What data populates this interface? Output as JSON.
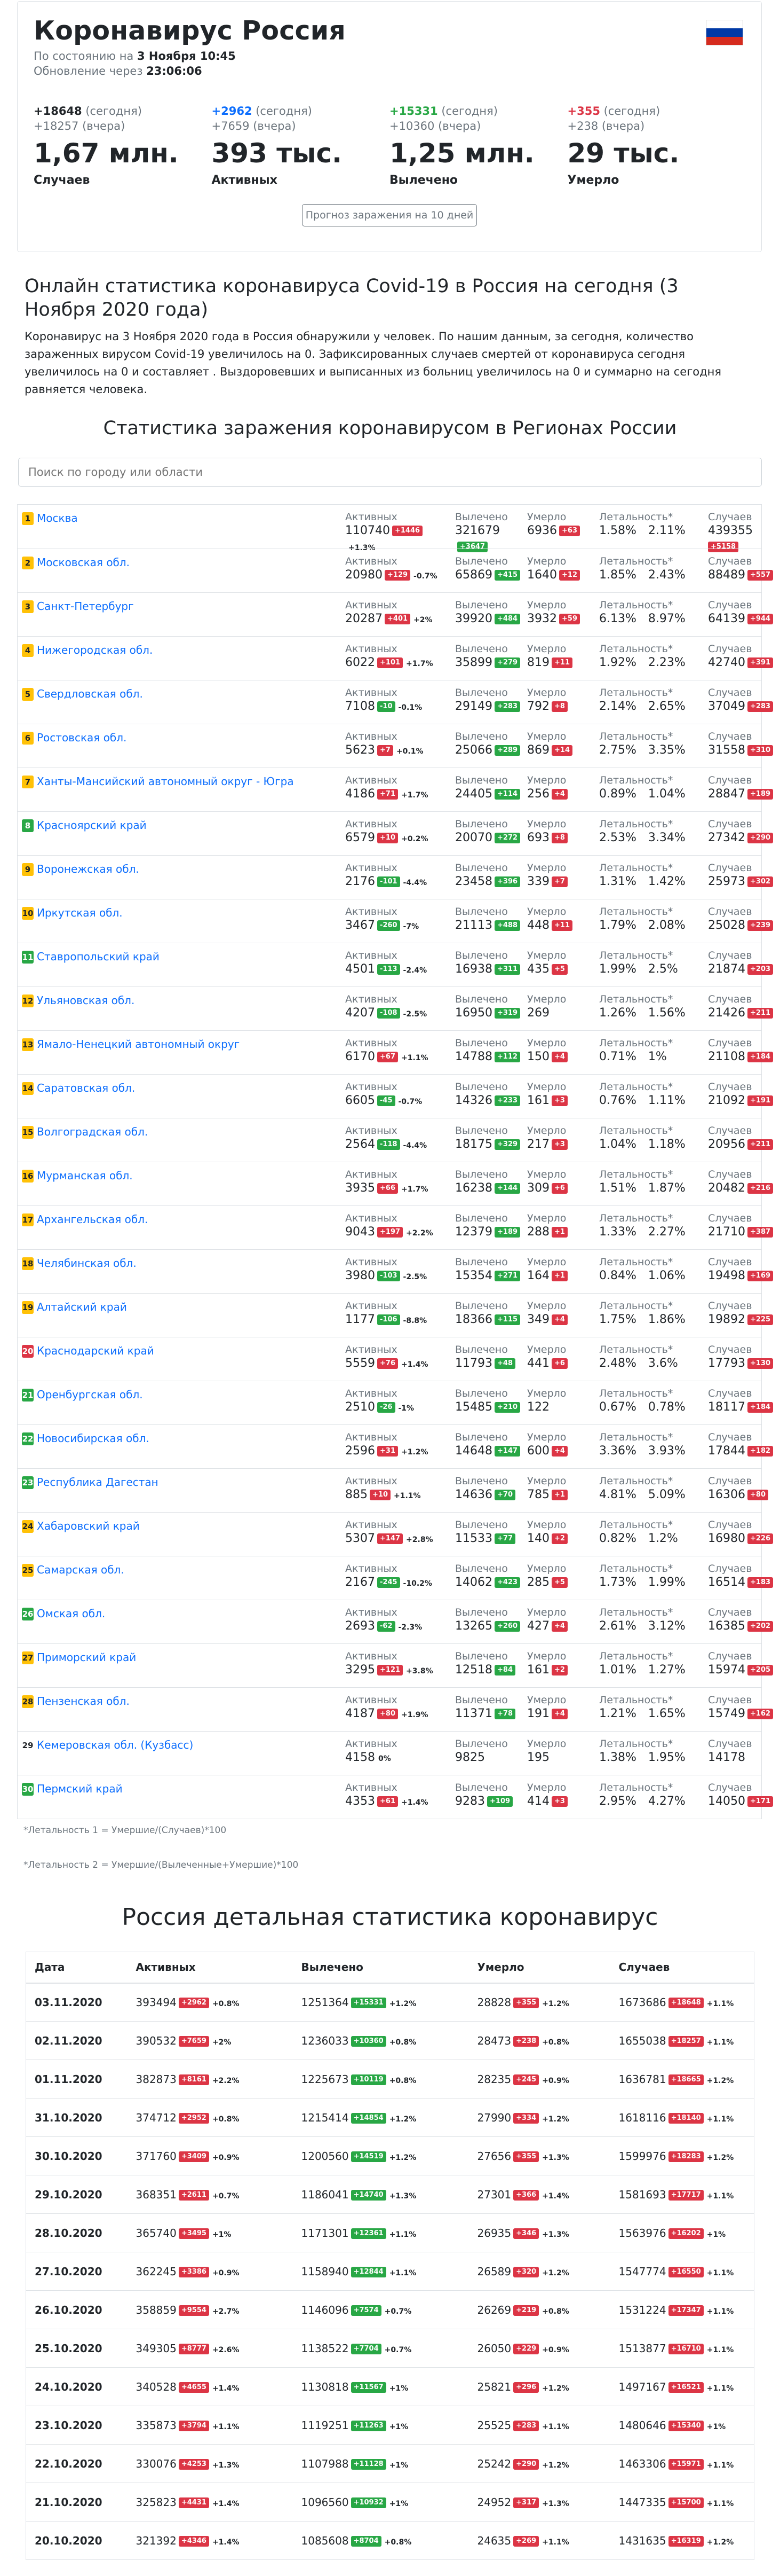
{
  "header": {
    "title": "Коронавирус Россия",
    "as_of_prefix": "По состоянию на",
    "as_of": "3 Ноября 10:45",
    "update_prefix": "Обновление через",
    "update_in": "23:06:06",
    "flag_colors": [
      "#ffffff",
      "#0039a6",
      "#d52b1e"
    ]
  },
  "stats": [
    {
      "today": "+18648",
      "today_lbl": "(сегодня)",
      "yest": "+18257",
      "yest_lbl": "(вчера)",
      "big": "1,67 млн.",
      "label": "Случаев",
      "color": "dark"
    },
    {
      "today": "+2962",
      "today_lbl": "(сегодня)",
      "yest": "+7659",
      "yest_lbl": "(вчера)",
      "big": "393 тыс.",
      "label": "Активных",
      "color": "blue"
    },
    {
      "today": "+15331",
      "today_lbl": "(сегодня)",
      "yest": "+10360",
      "yest_lbl": "(вчера)",
      "big": "1,25 млн.",
      "label": "Вылечено",
      "color": "green"
    },
    {
      "today": "+355",
      "today_lbl": "(сегодня)",
      "yest": "+238",
      "yest_lbl": "(вчера)",
      "big": "29 тыс.",
      "label": "Умерло",
      "color": "red"
    }
  ],
  "forecast_button": "Прогноз заражения на 10 дней",
  "intro": {
    "title": "Онлайн статистика коронавируса Covid-19 в Россия на сегодня (3 Ноября 2020 года)",
    "text": "Коронавирус на 3 Ноября 2020 года в Россия обнаружили у человек. По нашим данным, за сегодня, количество зараженных вирусом Covid-19 увеличилось на 0. Зафиксированных случаев смертей от коронавируса сегодня увеличилось на 0 и составляет . Выздоровевших и выписанных из больниц увеличилось на 0 и суммарно на сегодня равняется человека."
  },
  "regions_title": "Статистика заражения коронавирусом в Регионах России",
  "search_placeholder": "Поиск по городу или области",
  "col_labels": {
    "active": "Активных",
    "recovered": "Вылечено",
    "died": "Умерло",
    "leth": "Летальность*",
    "cases": "Случаев"
  },
  "regions": [
    {
      "rank": "1",
      "rc": "#ffc107",
      "name": "Москва",
      "active": "110740",
      "active_d": "+1446",
      "active_p": "+1.3%",
      "rec": "321679",
      "rec_d": "+3647",
      "died": "6936",
      "died_d": "+63",
      "l1": "1.58%",
      "l2": "2.11%",
      "cases": "439355",
      "cases_d": "+5158",
      "stack": true
    },
    {
      "rank": "2",
      "rc": "#ffc107",
      "name": "Московская обл.",
      "active": "20980",
      "active_d": "+129",
      "active_p": "-0.7%",
      "rec": "65869",
      "rec_d": "+415",
      "died": "1640",
      "died_d": "+12",
      "l1": "1.85%",
      "l2": "2.43%",
      "cases": "88489",
      "cases_d": "+557"
    },
    {
      "rank": "3",
      "rc": "#ffc107",
      "name": "Санкт-Петербург",
      "active": "20287",
      "active_d": "+401",
      "active_p": "+2%",
      "rec": "39920",
      "rec_d": "+484",
      "died": "3932",
      "died_d": "+59",
      "l1": "6.13%",
      "l2": "8.97%",
      "cases": "64139",
      "cases_d": "+944"
    },
    {
      "rank": "4",
      "rc": "#ffc107",
      "name": "Нижегородская обл.",
      "active": "6022",
      "active_d": "+101",
      "active_p": "+1.7%",
      "rec": "35899",
      "rec_d": "+279",
      "died": "819",
      "died_d": "+11",
      "l1": "1.92%",
      "l2": "2.23%",
      "cases": "42740",
      "cases_d": "+391"
    },
    {
      "rank": "5",
      "rc": "#ffc107",
      "name": "Свердловская обл.",
      "active": "7108",
      "active_d": "-10",
      "active_p": "-0.1%",
      "rec": "29149",
      "rec_d": "+283",
      "died": "792",
      "died_d": "+8",
      "l1": "2.14%",
      "l2": "2.65%",
      "cases": "37049",
      "cases_d": "+283"
    },
    {
      "rank": "6",
      "rc": "#ffc107",
      "name": "Ростовская обл.",
      "active": "5623",
      "active_d": "+7",
      "active_p": "+0.1%",
      "rec": "25066",
      "rec_d": "+289",
      "died": "869",
      "died_d": "+14",
      "l1": "2.75%",
      "l2": "3.35%",
      "cases": "31558",
      "cases_d": "+310"
    },
    {
      "rank": "7",
      "rc": "#ffc107",
      "name": "Ханты-Мансийский автономный округ - Югра",
      "active": "4186",
      "active_d": "+71",
      "active_p": "+1.7%",
      "rec": "24405",
      "rec_d": "+114",
      "died": "256",
      "died_d": "+4",
      "l1": "0.89%",
      "l2": "1.04%",
      "cases": "28847",
      "cases_d": "+189"
    },
    {
      "rank": "8",
      "rc": "#28a745",
      "name": "Красноярский край",
      "active": "6579",
      "active_d": "+10",
      "active_p": "+0.2%",
      "rec": "20070",
      "rec_d": "+272",
      "died": "693",
      "died_d": "+8",
      "l1": "2.53%",
      "l2": "3.34%",
      "cases": "27342",
      "cases_d": "+290"
    },
    {
      "rank": "9",
      "rc": "#ffc107",
      "name": "Воронежская обл.",
      "active": "2176",
      "active_d": "-101",
      "active_p": "-4.4%",
      "rec": "23458",
      "rec_d": "+396",
      "died": "339",
      "died_d": "+7",
      "l1": "1.31%",
      "l2": "1.42%",
      "cases": "25973",
      "cases_d": "+302"
    },
    {
      "rank": "10",
      "rc": "#ffc107",
      "name": "Иркутская обл.",
      "active": "3467",
      "active_d": "-260",
      "active_p": "-7%",
      "rec": "21113",
      "rec_d": "+488",
      "died": "448",
      "died_d": "+11",
      "l1": "1.79%",
      "l2": "2.08%",
      "cases": "25028",
      "cases_d": "+239"
    },
    {
      "rank": "11",
      "rc": "#28a745",
      "name": "Ставропольский край",
      "active": "4501",
      "active_d": "-113",
      "active_p": "-2.4%",
      "rec": "16938",
      "rec_d": "+311",
      "died": "435",
      "died_d": "+5",
      "l1": "1.99%",
      "l2": "2.5%",
      "cases": "21874",
      "cases_d": "+203"
    },
    {
      "rank": "12",
      "rc": "#ffc107",
      "name": "Ульяновская обл.",
      "active": "4207",
      "active_d": "-108",
      "active_p": "-2.5%",
      "rec": "16950",
      "rec_d": "+319",
      "died": "269",
      "died_d": "",
      "l1": "1.26%",
      "l2": "1.56%",
      "cases": "21426",
      "cases_d": "+211"
    },
    {
      "rank": "13",
      "rc": "#ffc107",
      "name": "Ямало-Ненецкий автономный округ",
      "active": "6170",
      "active_d": "+67",
      "active_p": "+1.1%",
      "rec": "14788",
      "rec_d": "+112",
      "died": "150",
      "died_d": "+4",
      "l1": "0.71%",
      "l2": "1%",
      "cases": "21108",
      "cases_d": "+184"
    },
    {
      "rank": "14",
      "rc": "#ffc107",
      "name": "Саратовская обл.",
      "active": "6605",
      "active_d": "-45",
      "active_p": "-0.7%",
      "rec": "14326",
      "rec_d": "+233",
      "died": "161",
      "died_d": "+3",
      "l1": "0.76%",
      "l2": "1.11%",
      "cases": "21092",
      "cases_d": "+191"
    },
    {
      "rank": "15",
      "rc": "#ffc107",
      "name": "Волгоградская обл.",
      "active": "2564",
      "active_d": "-118",
      "active_p": "-4.4%",
      "rec": "18175",
      "rec_d": "+329",
      "died": "217",
      "died_d": "+3",
      "l1": "1.04%",
      "l2": "1.18%",
      "cases": "20956",
      "cases_d": "+211"
    },
    {
      "rank": "16",
      "rc": "#ffc107",
      "name": "Мурманская обл.",
      "active": "3935",
      "active_d": "+66",
      "active_p": "+1.7%",
      "rec": "16238",
      "rec_d": "+144",
      "died": "309",
      "died_d": "+6",
      "l1": "1.51%",
      "l2": "1.87%",
      "cases": "20482",
      "cases_d": "+216"
    },
    {
      "rank": "17",
      "rc": "#ffc107",
      "name": "Архангельская обл.",
      "active": "9043",
      "active_d": "+197",
      "active_p": "+2.2%",
      "rec": "12379",
      "rec_d": "+189",
      "died": "288",
      "died_d": "+1",
      "l1": "1.33%",
      "l2": "2.27%",
      "cases": "21710",
      "cases_d": "+387"
    },
    {
      "rank": "18",
      "rc": "#ffc107",
      "name": "Челябинская обл.",
      "active": "3980",
      "active_d": "-103",
      "active_p": "-2.5%",
      "rec": "15354",
      "rec_d": "+271",
      "died": "164",
      "died_d": "+1",
      "l1": "0.84%",
      "l2": "1.06%",
      "cases": "19498",
      "cases_d": "+169"
    },
    {
      "rank": "19",
      "rc": "#ffc107",
      "name": "Алтайский край",
      "active": "1177",
      "active_d": "-106",
      "active_p": "-8.8%",
      "rec": "18366",
      "rec_d": "+115",
      "died": "349",
      "died_d": "+4",
      "l1": "1.75%",
      "l2": "1.86%",
      "cases": "19892",
      "cases_d": "+225"
    },
    {
      "rank": "20",
      "rc": "#dc3545",
      "name": "Краснодарский край",
      "active": "5559",
      "active_d": "+76",
      "active_p": "+1.4%",
      "rec": "11793",
      "rec_d": "+48",
      "died": "441",
      "died_d": "+6",
      "l1": "2.48%",
      "l2": "3.6%",
      "cases": "17793",
      "cases_d": "+130"
    },
    {
      "rank": "21",
      "rc": "#28a745",
      "name": "Оренбургская обл.",
      "active": "2510",
      "active_d": "-26",
      "active_p": "-1%",
      "rec": "15485",
      "rec_d": "+210",
      "died": "122",
      "died_d": "",
      "l1": "0.67%",
      "l2": "0.78%",
      "cases": "18117",
      "cases_d": "+184"
    },
    {
      "rank": "22",
      "rc": "#28a745",
      "name": "Новосибирская обл.",
      "active": "2596",
      "active_d": "+31",
      "active_p": "+1.2%",
      "rec": "14648",
      "rec_d": "+147",
      "died": "600",
      "died_d": "+4",
      "l1": "3.36%",
      "l2": "3.93%",
      "cases": "17844",
      "cases_d": "+182"
    },
    {
      "rank": "23",
      "rc": "#28a745",
      "name": "Республика Дагестан",
      "active": "885",
      "active_d": "+10",
      "active_p": "+1.1%",
      "rec": "14636",
      "rec_d": "+70",
      "died": "785",
      "died_d": "+1",
      "l1": "4.81%",
      "l2": "5.09%",
      "cases": "16306",
      "cases_d": "+80"
    },
    {
      "rank": "24",
      "rc": "#ffc107",
      "name": "Хабаровский край",
      "active": "5307",
      "active_d": "+147",
      "active_p": "+2.8%",
      "rec": "11533",
      "rec_d": "+77",
      "died": "140",
      "died_d": "+2",
      "l1": "0.82%",
      "l2": "1.2%",
      "cases": "16980",
      "cases_d": "+226"
    },
    {
      "rank": "25",
      "rc": "#ffc107",
      "name": "Самарская обл.",
      "active": "2167",
      "active_d": "-245",
      "active_p": "-10.2%",
      "rec": "14062",
      "rec_d": "+423",
      "died": "285",
      "died_d": "+5",
      "l1": "1.73%",
      "l2": "1.99%",
      "cases": "16514",
      "cases_d": "+183"
    },
    {
      "rank": "26",
      "rc": "#28a745",
      "name": "Омская обл.",
      "active": "2693",
      "active_d": "-62",
      "active_p": "-2.3%",
      "rec": "13265",
      "rec_d": "+260",
      "died": "427",
      "died_d": "+4",
      "l1": "2.61%",
      "l2": "3.12%",
      "cases": "16385",
      "cases_d": "+202"
    },
    {
      "rank": "27",
      "rc": "#ffc107",
      "name": "Приморский край",
      "active": "3295",
      "active_d": "+121",
      "active_p": "+3.8%",
      "rec": "12518",
      "rec_d": "+84",
      "died": "161",
      "died_d": "+2",
      "l1": "1.01%",
      "l2": "1.27%",
      "cases": "15974",
      "cases_d": "+205"
    },
    {
      "rank": "28",
      "rc": "#ffc107",
      "name": "Пензенская обл.",
      "active": "4187",
      "active_d": "+80",
      "active_p": "+1.9%",
      "rec": "11371",
      "rec_d": "+78",
      "died": "191",
      "died_d": "+4",
      "l1": "1.21%",
      "l2": "1.65%",
      "cases": "15749",
      "cases_d": "+162"
    },
    {
      "rank": "29",
      "rc": "",
      "name": "Кемеровская обл. (Кузбасс)",
      "active": "4158",
      "active_d": "",
      "active_p": "0%",
      "rec": "9825",
      "rec_d": "",
      "died": "195",
      "died_d": "",
      "l1": "1.38%",
      "l2": "1.95%",
      "cases": "14178",
      "cases_d": ""
    },
    {
      "rank": "30",
      "rc": "#28a745",
      "name": "Пермский край",
      "active": "4353",
      "active_d": "+61",
      "active_p": "+1.4%",
      "rec": "9283",
      "rec_d": "+109",
      "died": "414",
      "died_d": "+3",
      "l1": "2.95%",
      "l2": "4.27%",
      "cases": "14050",
      "cases_d": "+171"
    }
  ],
  "notes": {
    "n1": "*Летальность 1 = Умершие/(Случаев)*100",
    "n2": "*Летальность 2 = Умершие/(Вылеченные+Умершие)*100"
  },
  "detail_title": "Россия детальная статистика коронавирус",
  "detail_headers": [
    "Дата",
    "Активных",
    "Вылечено",
    "Умерло",
    "Случаев"
  ],
  "detail_rows": [
    {
      "date": "03.11.2020",
      "a": "393494",
      "ad": "+2962",
      "ap": "+0.8%",
      "r": "1251364",
      "rd": "+15331",
      "rp": "+1.2%",
      "m": "28828",
      "md": "+355",
      "mp": "+1.2%",
      "c": "1673686",
      "cd": "+18648",
      "cp": "+1.1%"
    },
    {
      "date": "02.11.2020",
      "a": "390532",
      "ad": "+7659",
      "ap": "+2%",
      "r": "1236033",
      "rd": "+10360",
      "rp": "+0.8%",
      "m": "28473",
      "md": "+238",
      "mp": "+0.8%",
      "c": "1655038",
      "cd": "+18257",
      "cp": "+1.1%"
    },
    {
      "date": "01.11.2020",
      "a": "382873",
      "ad": "+8161",
      "ap": "+2.2%",
      "r": "1225673",
      "rd": "+10119",
      "rp": "+0.8%",
      "m": "28235",
      "md": "+245",
      "mp": "+0.9%",
      "c": "1636781",
      "cd": "+18665",
      "cp": "+1.2%"
    },
    {
      "date": "31.10.2020",
      "a": "374712",
      "ad": "+2952",
      "ap": "+0.8%",
      "r": "1215414",
      "rd": "+14854",
      "rp": "+1.2%",
      "m": "27990",
      "md": "+334",
      "mp": "+1.2%",
      "c": "1618116",
      "cd": "+18140",
      "cp": "+1.1%"
    },
    {
      "date": "30.10.2020",
      "a": "371760",
      "ad": "+3409",
      "ap": "+0.9%",
      "r": "1200560",
      "rd": "+14519",
      "rp": "+1.2%",
      "m": "27656",
      "md": "+355",
      "mp": "+1.3%",
      "c": "1599976",
      "cd": "+18283",
      "cp": "+1.2%"
    },
    {
      "date": "29.10.2020",
      "a": "368351",
      "ad": "+2611",
      "ap": "+0.7%",
      "r": "1186041",
      "rd": "+14740",
      "rp": "+1.3%",
      "m": "27301",
      "md": "+366",
      "mp": "+1.4%",
      "c": "1581693",
      "cd": "+17717",
      "cp": "+1.1%"
    },
    {
      "date": "28.10.2020",
      "a": "365740",
      "ad": "+3495",
      "ap": "+1%",
      "r": "1171301",
      "rd": "+12361",
      "rp": "+1.1%",
      "m": "26935",
      "md": "+346",
      "mp": "+1.3%",
      "c": "1563976",
      "cd": "+16202",
      "cp": "+1%"
    },
    {
      "date": "27.10.2020",
      "a": "362245",
      "ad": "+3386",
      "ap": "+0.9%",
      "r": "1158940",
      "rd": "+12844",
      "rp": "+1.1%",
      "m": "26589",
      "md": "+320",
      "mp": "+1.2%",
      "c": "1547774",
      "cd": "+16550",
      "cp": "+1.1%"
    },
    {
      "date": "26.10.2020",
      "a": "358859",
      "ad": "+9554",
      "ap": "+2.7%",
      "r": "1146096",
      "rd": "+7574",
      "rp": "+0.7%",
      "m": "26269",
      "md": "+219",
      "mp": "+0.8%",
      "c": "1531224",
      "cd": "+17347",
      "cp": "+1.1%"
    },
    {
      "date": "25.10.2020",
      "a": "349305",
      "ad": "+8777",
      "ap": "+2.6%",
      "r": "1138522",
      "rd": "+7704",
      "rp": "+0.7%",
      "m": "26050",
      "md": "+229",
      "mp": "+0.9%",
      "c": "1513877",
      "cd": "+16710",
      "cp": "+1.1%"
    },
    {
      "date": "24.10.2020",
      "a": "340528",
      "ad": "+4655",
      "ap": "+1.4%",
      "r": "1130818",
      "rd": "+11567",
      "rp": "+1%",
      "m": "25821",
      "md": "+296",
      "mp": "+1.2%",
      "c": "1497167",
      "cd": "+16521",
      "cp": "+1.1%"
    },
    {
      "date": "23.10.2020",
      "a": "335873",
      "ad": "+3794",
      "ap": "+1.1%",
      "r": "1119251",
      "rd": "+11263",
      "rp": "+1%",
      "m": "25525",
      "md": "+283",
      "mp": "+1.1%",
      "c": "1480646",
      "cd": "+15340",
      "cp": "+1%"
    },
    {
      "date": "22.10.2020",
      "a": "330076",
      "ad": "+4253",
      "ap": "+1.3%",
      "r": "1107988",
      "rd": "+11128",
      "rp": "+1%",
      "m": "25242",
      "md": "+290",
      "mp": "+1.2%",
      "c": "1463306",
      "cd": "+15971",
      "cp": "+1.1%"
    },
    {
      "date": "21.10.2020",
      "a": "325823",
      "ad": "+4431",
      "ap": "+1.4%",
      "r": "1096560",
      "rd": "+10932",
      "rp": "+1%",
      "m": "24952",
      "md": "+317",
      "mp": "+1.3%",
      "c": "1447335",
      "cd": "+15700",
      "cp": "+1.1%"
    },
    {
      "date": "20.10.2020",
      "a": "321392",
      "ad": "+4346",
      "ap": "+1.4%",
      "r": "1085608",
      "rd": "+8704",
      "rp": "+0.8%",
      "m": "24635",
      "md": "+269",
      "mp": "+1.1%",
      "c": "1431635",
      "cd": "+16319",
      "cp": "+1.2%"
    }
  ]
}
